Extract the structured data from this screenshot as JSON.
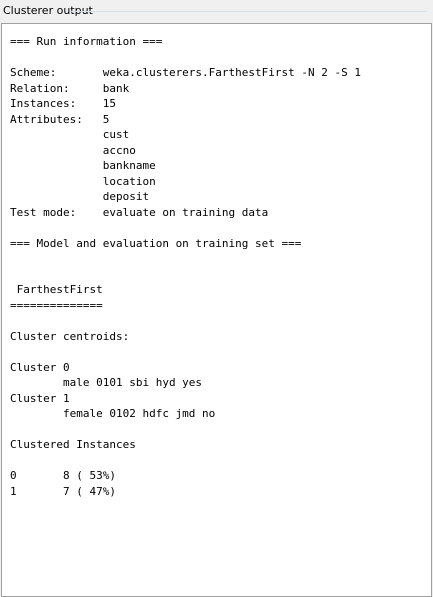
{
  "panel": {
    "title": "Clusterer output"
  },
  "output": {
    "lines": [
      "=== Run information ===",
      "",
      "Scheme:       weka.clusterers.FarthestFirst -N 2 -S 1",
      "Relation:     bank",
      "Instances:    15",
      "Attributes:   5",
      "              cust",
      "              accno",
      "              bankname",
      "              location",
      "              deposit",
      "Test mode:    evaluate on training data",
      "",
      "=== Model and evaluation on training set ===",
      "",
      "",
      " FarthestFirst",
      "==============",
      "",
      "Cluster centroids:",
      "",
      "Cluster 0",
      "        male 0101 sbi hyd yes",
      "Cluster 1",
      "        female 0102 hdfc jmd no",
      "",
      "Clustered Instances",
      "",
      "0       8 ( 53%)",
      "1       7 ( 47%)"
    ]
  }
}
